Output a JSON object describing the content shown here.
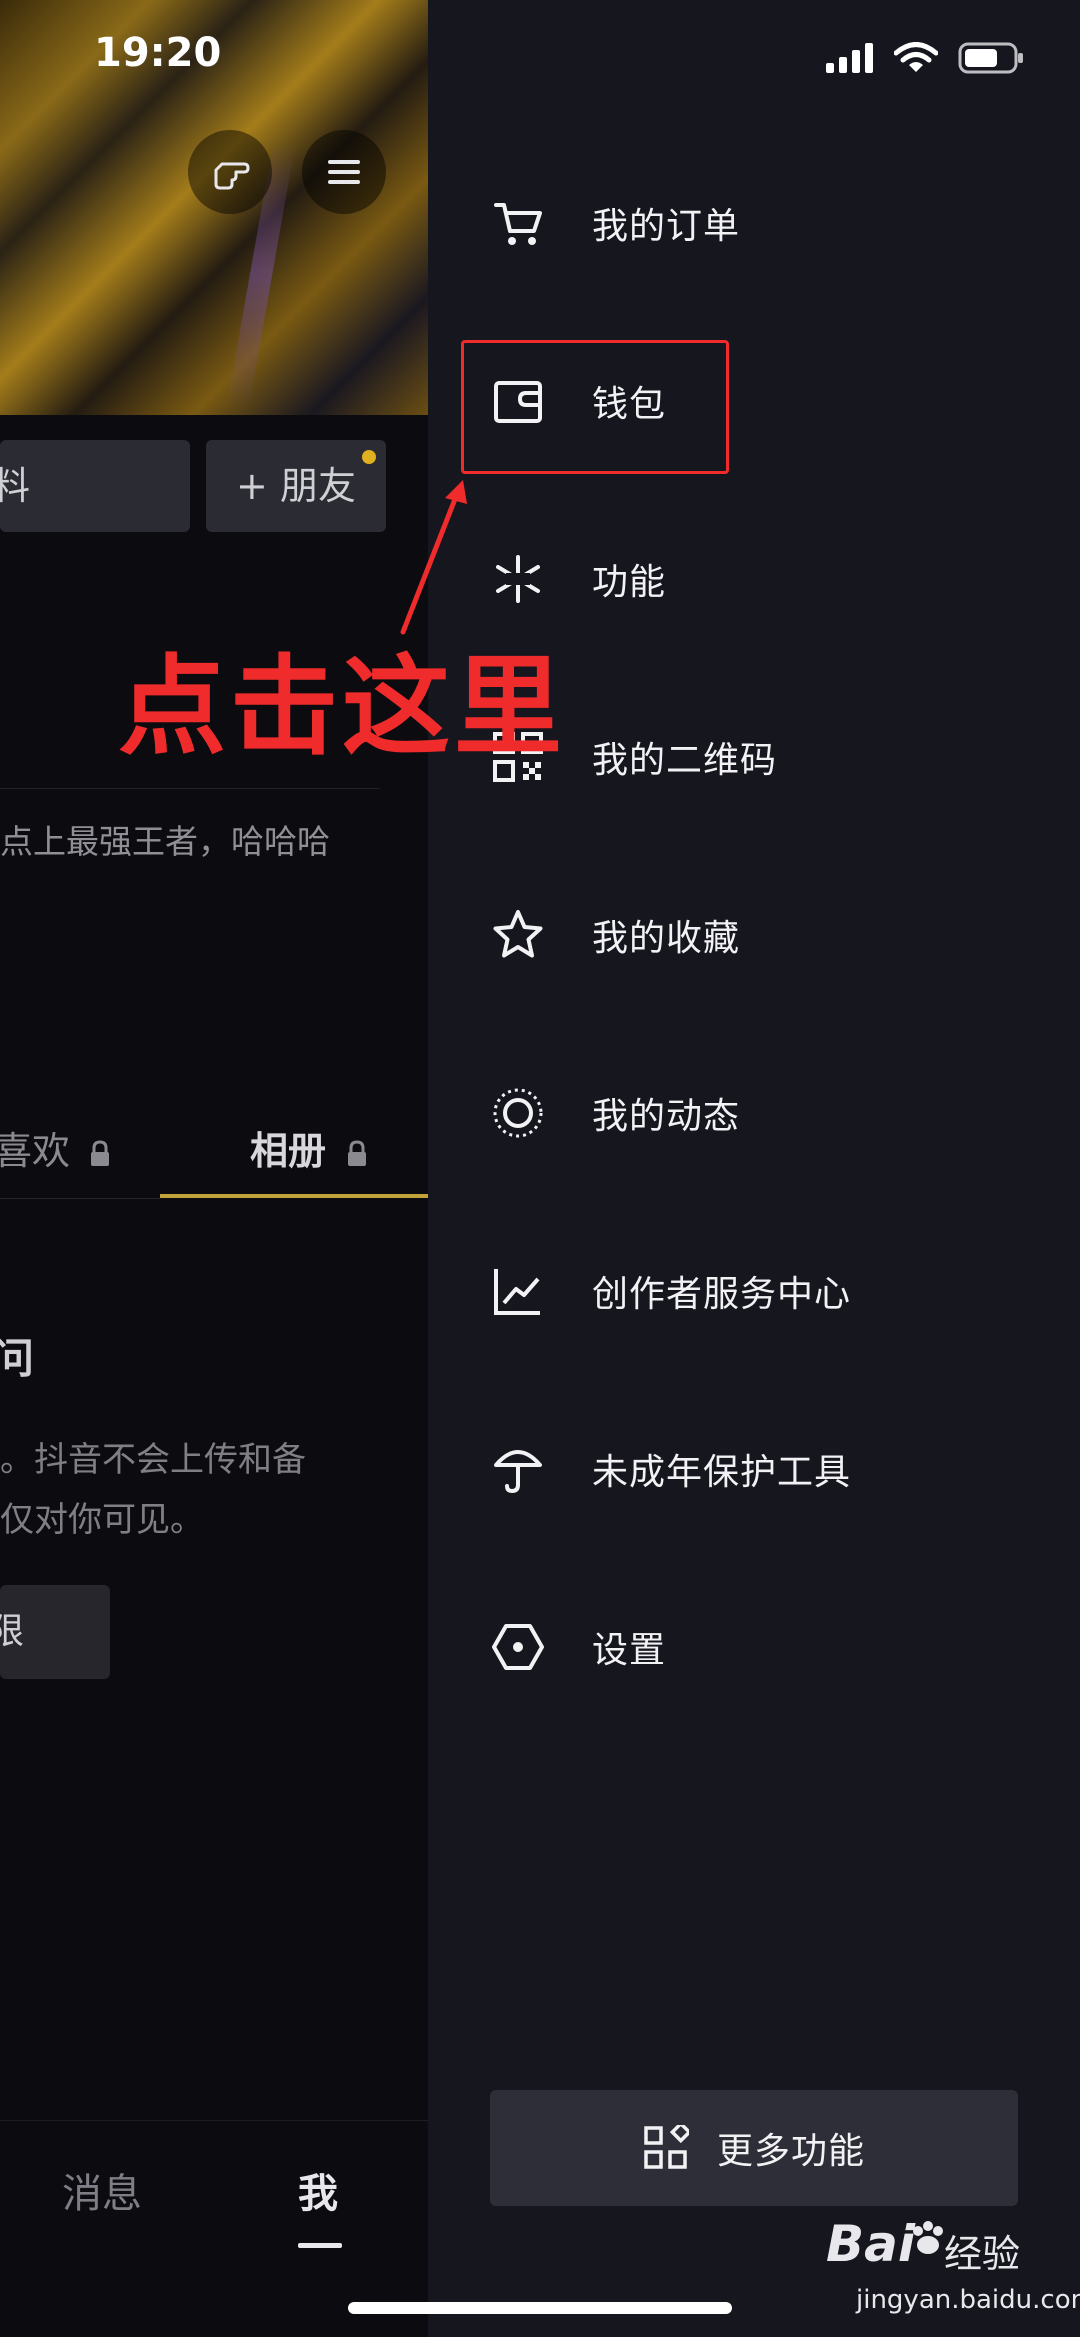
{
  "status_bar": {
    "time": "19:20"
  },
  "profile": {
    "edit_button_partial": "料",
    "add_friend_label": "+ 朋友",
    "bio_partial": "点上最强王者，哈哈哈",
    "tabs": [
      {
        "label": "喜欢"
      },
      {
        "label": "相册"
      }
    ],
    "album": {
      "title_partial": "问",
      "desc_line1": "。抖音不会上传和备",
      "desc_line2": "仅对你可见。",
      "button_partial": "限"
    },
    "bottom_nav": [
      {
        "label": "消息"
      },
      {
        "label": "我"
      }
    ]
  },
  "drawer": {
    "items": [
      {
        "label": "我的订单",
        "icon": "cart-icon"
      },
      {
        "label": "钱包",
        "icon": "wallet-icon"
      },
      {
        "label": "功能",
        "icon": "function-icon"
      },
      {
        "label": "我的二维码",
        "icon": "qrcode-icon"
      },
      {
        "label": "我的收藏",
        "icon": "star-icon"
      },
      {
        "label": "我的动态",
        "icon": "activity-icon"
      },
      {
        "label": "创作者服务中心",
        "icon": "chart-icon"
      },
      {
        "label": "未成年保护工具",
        "icon": "umbrella-icon"
      },
      {
        "label": "设置",
        "icon": "settings-icon"
      }
    ],
    "more_button": {
      "label": "更多功能",
      "icon": "grid-icon"
    }
  },
  "annotation": {
    "text": "点击这里",
    "color": "#ef2b2b"
  },
  "watermark": {
    "brand": "Bai",
    "brand_cn": "经验",
    "domain": "jingyan.baidu.com"
  }
}
